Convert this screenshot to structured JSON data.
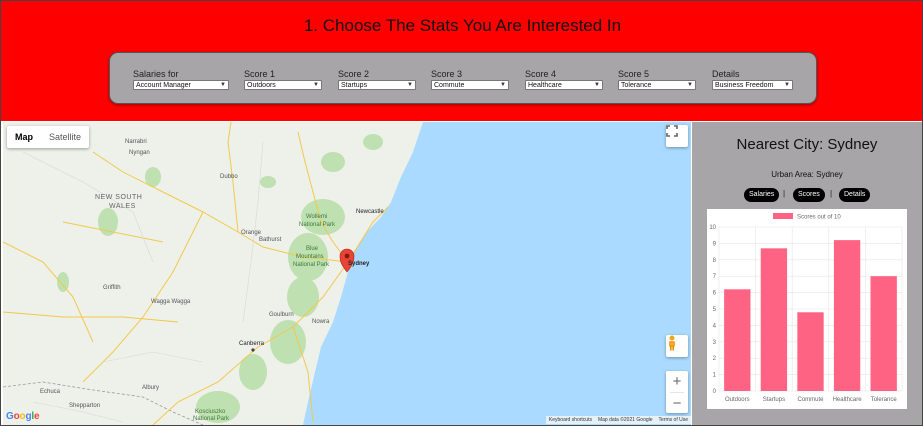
{
  "header": {
    "title": "1. Choose The Stats You Are Interested In",
    "fields": [
      {
        "label": "Salaries for",
        "value": "Account Manager"
      },
      {
        "label": "Score 1",
        "value": "Outdoors"
      },
      {
        "label": "Score 2",
        "value": "Startups"
      },
      {
        "label": "Score 3",
        "value": "Commute"
      },
      {
        "label": "Score 4",
        "value": "Healthcare"
      },
      {
        "label": "Score 5",
        "value": "Tolerance"
      },
      {
        "label": "Details",
        "value": "Business Freedom"
      }
    ]
  },
  "map": {
    "type_map": "Map",
    "type_satellite": "Satellite",
    "zoom_in": "+",
    "zoom_out": "−",
    "logo": "Google",
    "attribution": [
      "Keyboard shortcuts",
      "Map data ©2021 Google",
      "Terms of Use"
    ],
    "places": {
      "nsw_1": "NEW SOUTH",
      "nsw_2": "WALES",
      "dubbo": "Dubbo",
      "orange": "Orange",
      "bathurst": "Bathurst",
      "newcastle": "Newcastle",
      "sydney": "Sydney",
      "wollemi_1": "Wollemi",
      "wollemi_2": "National Park",
      "blue_1": "Blue",
      "blue_2": "Mountains",
      "blue_3": "National Park",
      "wagga": "Wagga Wagga",
      "griffith": "Griffith",
      "canberra": "Canberra",
      "goulburn": "Goulburn",
      "nowra": "Nowra",
      "albury": "Albury",
      "echuca": "Echuca",
      "shepparton": "Shepparton",
      "kosciuszko_1": "Kosciuszko",
      "kosciuszko_2": "National Park",
      "narrabri": "Narrabri",
      "nyngan": "Nyngan"
    }
  },
  "side": {
    "title": "Nearest City: Sydney",
    "urban_area": "Urban Area: Sydney",
    "buttons": [
      "Salaries",
      "Scores",
      "Details"
    ],
    "separator": "|"
  },
  "chart_data": {
    "type": "bar",
    "legend": "Scores out of 10",
    "categories": [
      "Outdoors",
      "Startups",
      "Commute",
      "Healthcare",
      "Tolerance"
    ],
    "values": [
      6.2,
      8.7,
      4.8,
      9.2,
      7.0
    ],
    "ylim": [
      0,
      10
    ],
    "yticks": [
      0,
      1,
      2,
      3,
      4,
      5,
      6,
      7,
      8,
      9,
      10
    ],
    "bar_color": "#ff6384",
    "grid": true,
    "legend_position": "top"
  },
  "colors": {
    "header": "#ff0000",
    "panel": "#a7a5a7",
    "ocean": "#aadaff",
    "land": "#eef0ea",
    "park": "#bfe0b0"
  }
}
